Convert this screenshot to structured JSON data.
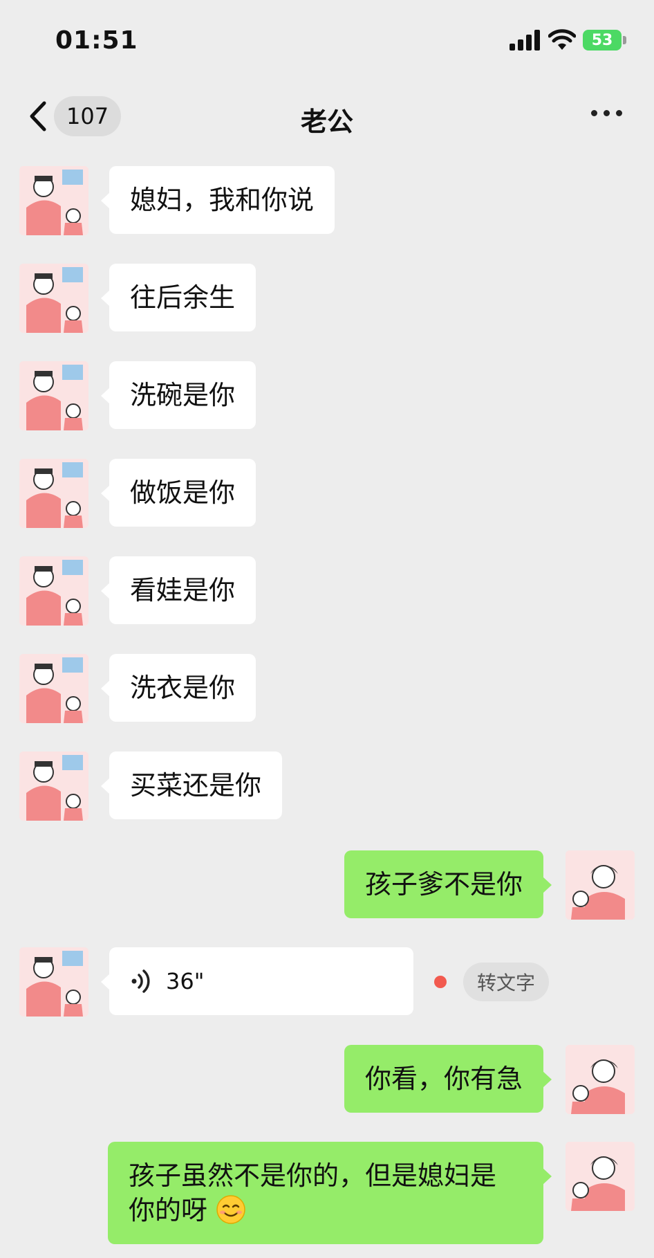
{
  "status_bar": {
    "time": "01:51",
    "battery": "53"
  },
  "nav": {
    "unread_count": "107",
    "title": "老公"
  },
  "messages": [
    {
      "dir": "in",
      "text": "媳妇，我和你说"
    },
    {
      "dir": "in",
      "text": "往后余生"
    },
    {
      "dir": "in",
      "text": "洗碗是你"
    },
    {
      "dir": "in",
      "text": "做饭是你"
    },
    {
      "dir": "in",
      "text": "看娃是你"
    },
    {
      "dir": "in",
      "text": "洗衣是你"
    },
    {
      "dir": "in",
      "text": "买菜还是你"
    },
    {
      "dir": "out",
      "text": "孩子爹不是你"
    },
    {
      "dir": "in",
      "type": "voice",
      "duration": "36\"",
      "action": "转文字"
    },
    {
      "dir": "out",
      "text": "你看，你有急"
    },
    {
      "dir": "out",
      "text_line1": "孩子虽然不是你的，但是媳妇是",
      "text_line2": "你的呀",
      "emoji": "smiling-face-emoji"
    }
  ],
  "colors": {
    "background": "#ededed",
    "outgoing_bubble": "#95ec69",
    "incoming_bubble": "#ffffff",
    "unread_dot": "#f25a4f"
  }
}
